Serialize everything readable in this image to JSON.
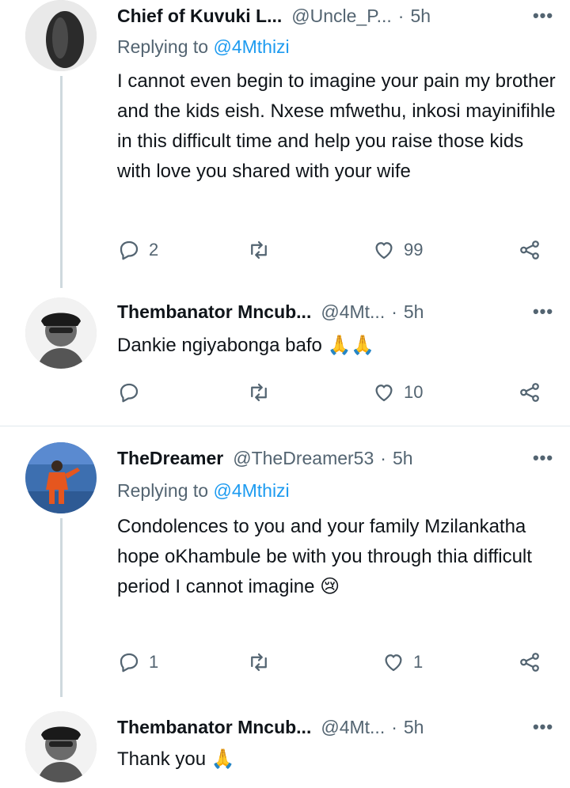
{
  "replies": [
    {
      "name": "Chief of Kuvuki L...",
      "handle": "@Uncle_P...",
      "time": "5h",
      "replying_prefix": "Replying to",
      "replying_to": "@4Mthizi",
      "text": "I cannot even begin to imagine your pain my brother and the kids eish. Nxese mfwethu, inkosi mayinifihle in this difficult time and help you raise those kids with love you shared with your wife",
      "reply_count": "2",
      "retweet_count": "",
      "like_count": "99"
    },
    {
      "name": "Thembanator Mncub...",
      "handle": "@4Mt...",
      "time": "5h",
      "text": "Dankie ngiyabonga bafo",
      "emoji": "🙏🙏",
      "reply_count": "",
      "retweet_count": "",
      "like_count": "10"
    },
    {
      "name": "TheDreamer",
      "handle": "@TheDreamer53",
      "time": "5h",
      "replying_prefix": "Replying to",
      "replying_to": "@4Mthizi",
      "text": "Condolences  to you and your family Mzilankatha hope oKhambule be with you through thia difficult period I cannot imagine",
      "emoji": "😢",
      "reply_count": "1",
      "retweet_count": "",
      "like_count": "1"
    },
    {
      "name": "Thembanator Mncub...",
      "handle": "@4Mt...",
      "time": "5h",
      "text": "Thank you",
      "emoji": "🙏"
    }
  ],
  "icons": {
    "reply": "reply-icon",
    "retweet": "retweet-icon",
    "like": "heart-icon",
    "share": "share-icon",
    "more": "more-icon"
  },
  "colors": {
    "link": "#1d9bf0",
    "secondary_text": "#536471",
    "thread_line": "#cfd9de"
  }
}
